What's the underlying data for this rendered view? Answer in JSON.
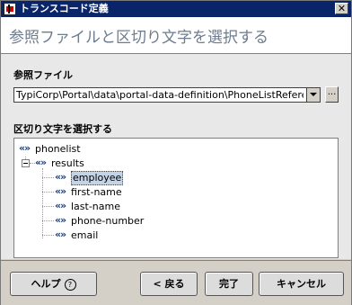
{
  "window": {
    "title": "トランスコード定義",
    "close_glyph": "✕"
  },
  "header": {
    "title": "参照ファイルと区切り文字を選択する"
  },
  "reference_file": {
    "label": "参照ファイル",
    "value": "TypiCorp\\Portal\\data\\portal-data-definition\\PhoneListReference.xml",
    "browse_label": "..."
  },
  "delimiter": {
    "label": "区切り文字を選択する",
    "tree": {
      "root": "phonelist",
      "group": "results",
      "children": [
        "employee",
        "first-name",
        "last-name",
        "phone-number",
        "email"
      ],
      "selected": "employee"
    }
  },
  "footer": {
    "help_label": "ヘルプ",
    "help_glyph": "?",
    "back_label": "< 戻る",
    "finish_label": "完了",
    "cancel_label": "キャンセル"
  }
}
